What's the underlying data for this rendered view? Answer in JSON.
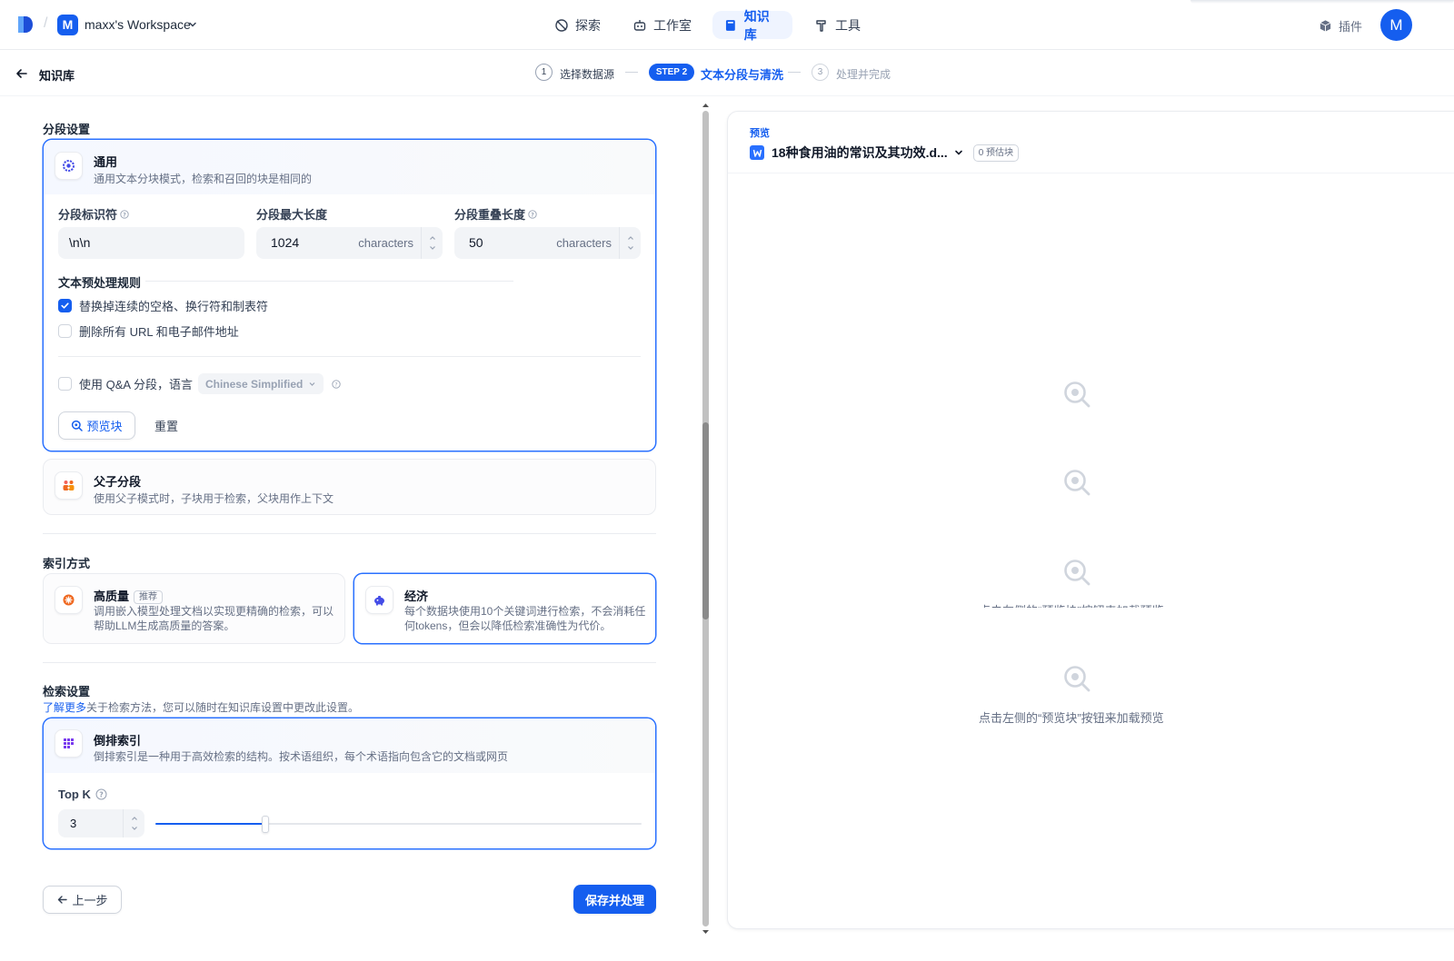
{
  "workspace": {
    "avatar_letter": "M",
    "name": "maxx's Workspace"
  },
  "nav": {
    "explore": "探索",
    "studio": "工作室",
    "knowledge": "知识库",
    "tools": "工具"
  },
  "plugins_label": "插件",
  "user_avatar_letter": "M",
  "subheader": {
    "back_title": "知识库",
    "steps": [
      {
        "num": "1",
        "label": "选择数据源"
      },
      {
        "badge": "STEP 2",
        "label": "文本分段与清洗"
      },
      {
        "num": "3",
        "label": "处理并完成"
      }
    ]
  },
  "segment": {
    "section_title": "分段设置",
    "general": {
      "title": "通用",
      "desc": "通用文本分块模式，检索和召回的块是相同的"
    },
    "delimiter": {
      "label": "分段标识符",
      "value": "\\n\\n"
    },
    "max_length": {
      "label": "分段最大长度",
      "value": "1024",
      "unit": "characters"
    },
    "overlap": {
      "label": "分段重叠长度",
      "value": "50",
      "unit": "characters"
    },
    "rules_title": "文本预处理规则",
    "rule_whitespace": "替换掉连续的空格、换行符和制表符",
    "rule_urls": "删除所有 URL 和电子邮件地址",
    "qa_label": "使用 Q&A 分段，语言",
    "qa_language": "Chinese Simplified",
    "preview_button": "预览块",
    "reset_button": "重置",
    "parent_child": {
      "title": "父子分段",
      "desc": "使用父子模式时，子块用于检索，父块用作上下文"
    }
  },
  "index": {
    "section_title": "索引方式",
    "high_quality": {
      "title": "高质量",
      "tag": "推荐",
      "desc": "调用嵌入模型处理文档以实现更精确的检索，可以帮助LLM生成高质量的答案。"
    },
    "economy": {
      "title": "经济",
      "desc": "每个数据块使用10个关键词进行检索，不会消耗任何tokens，但会以降低检索准确性为代价。"
    }
  },
  "retrieval": {
    "section_title": "检索设置",
    "learn_more": "了解更多",
    "learn_desc": "关于检索方法，您可以随时在知识库设置中更改此设置。",
    "inverted": {
      "title": "倒排索引",
      "desc": "倒排索引是一种用于高效检索的结构。按术语组织，每个术语指向包含它的文档或网页"
    },
    "topk_label": "Top K",
    "topk_value": "3",
    "topk_slider_fraction": 0.227
  },
  "footer": {
    "prev_button": "上一步",
    "save_button": "保存并处理"
  },
  "preview": {
    "label": "预览",
    "file_name": "18种食用油的常识及其功效.d...",
    "chunk_count": "0 预估块",
    "empty_text": "点击左侧的“预览块”按钮来加载预览"
  },
  "colors": {
    "accent": "#155eef",
    "border_selected": "#2970ff"
  }
}
